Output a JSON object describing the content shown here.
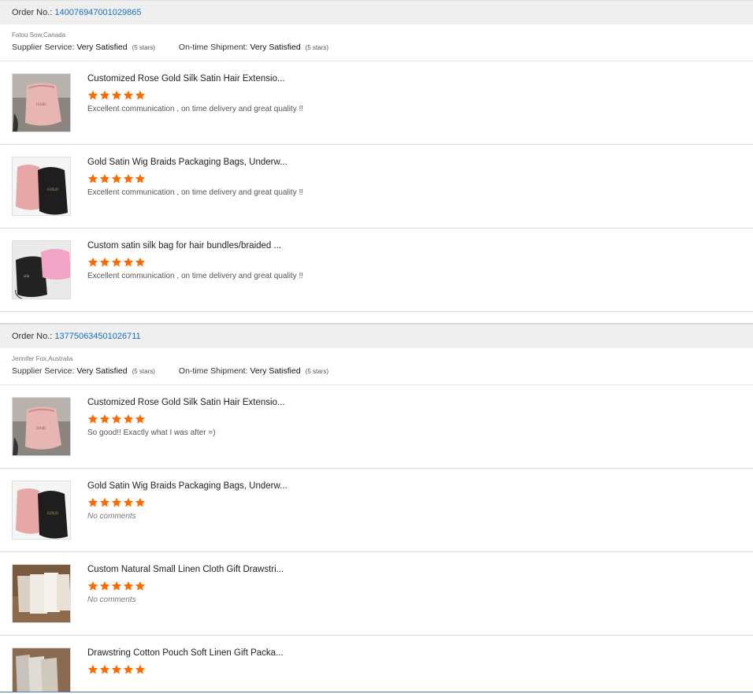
{
  "order_label": "Order No.:",
  "orders": [
    {
      "number": "140076947001029865",
      "buyer": "Fatou Sow,Canada",
      "supplier_label": "Supplier Service:",
      "supplier_value": "Very Satisfied",
      "supplier_stars": "(5 stars)",
      "shipment_label": "On-time Shipment:",
      "shipment_value": "Very Satisfied",
      "shipment_stars": "(5 stars)",
      "items": [
        {
          "title": "Customized Rose Gold Silk Satin Hair Extensio...",
          "rating": 5,
          "comment": "Excellent communication , on time delivery and great quality !!",
          "thumb": "pink-satin-bag-image"
        },
        {
          "title": "Gold Satin Wig Braids Packaging Bags, Underw...",
          "rating": 5,
          "comment": "Excellent communication , on time delivery and great quality !!",
          "thumb": "pink-black-bags-image"
        },
        {
          "title": "Custom satin silk bag for hair bundles/braided ...",
          "rating": 5,
          "comment": "Excellent communication , on time delivery and great quality !!",
          "thumb": "black-pink-bags-image"
        }
      ]
    },
    {
      "number": "137750634501026711",
      "buyer": "Jennifer Fox,Australia",
      "supplier_label": "Supplier Service:",
      "supplier_value": "Very Satisfied",
      "supplier_stars": "(5 stars)",
      "shipment_label": "On-time Shipment:",
      "shipment_value": "Very Satisfied",
      "shipment_stars": "(5 stars)",
      "items": [
        {
          "title": "Customized Rose Gold Silk Satin Hair Extensio...",
          "rating": 5,
          "comment": "So good!! Exactly what I was after =)",
          "thumb": "pink-satin-bag-image"
        },
        {
          "title": "Gold Satin Wig Braids Packaging Bags, Underw...",
          "rating": 5,
          "comment": "No comments",
          "thumb": "pink-black-bags-image"
        },
        {
          "title": "Custom Natural Small Linen Cloth Gift Drawstri...",
          "rating": 5,
          "comment": "No comments",
          "thumb": "linen-bags-image"
        },
        {
          "title": "Drawstring Cotton Pouch Soft Linen Gift Packa...",
          "rating": 5,
          "comment": "",
          "thumb": "cotton-pouch-image"
        }
      ]
    }
  ],
  "colors": {
    "star": "#ff6a00",
    "link": "#1a6fc1",
    "header_bg": "#efefef"
  }
}
